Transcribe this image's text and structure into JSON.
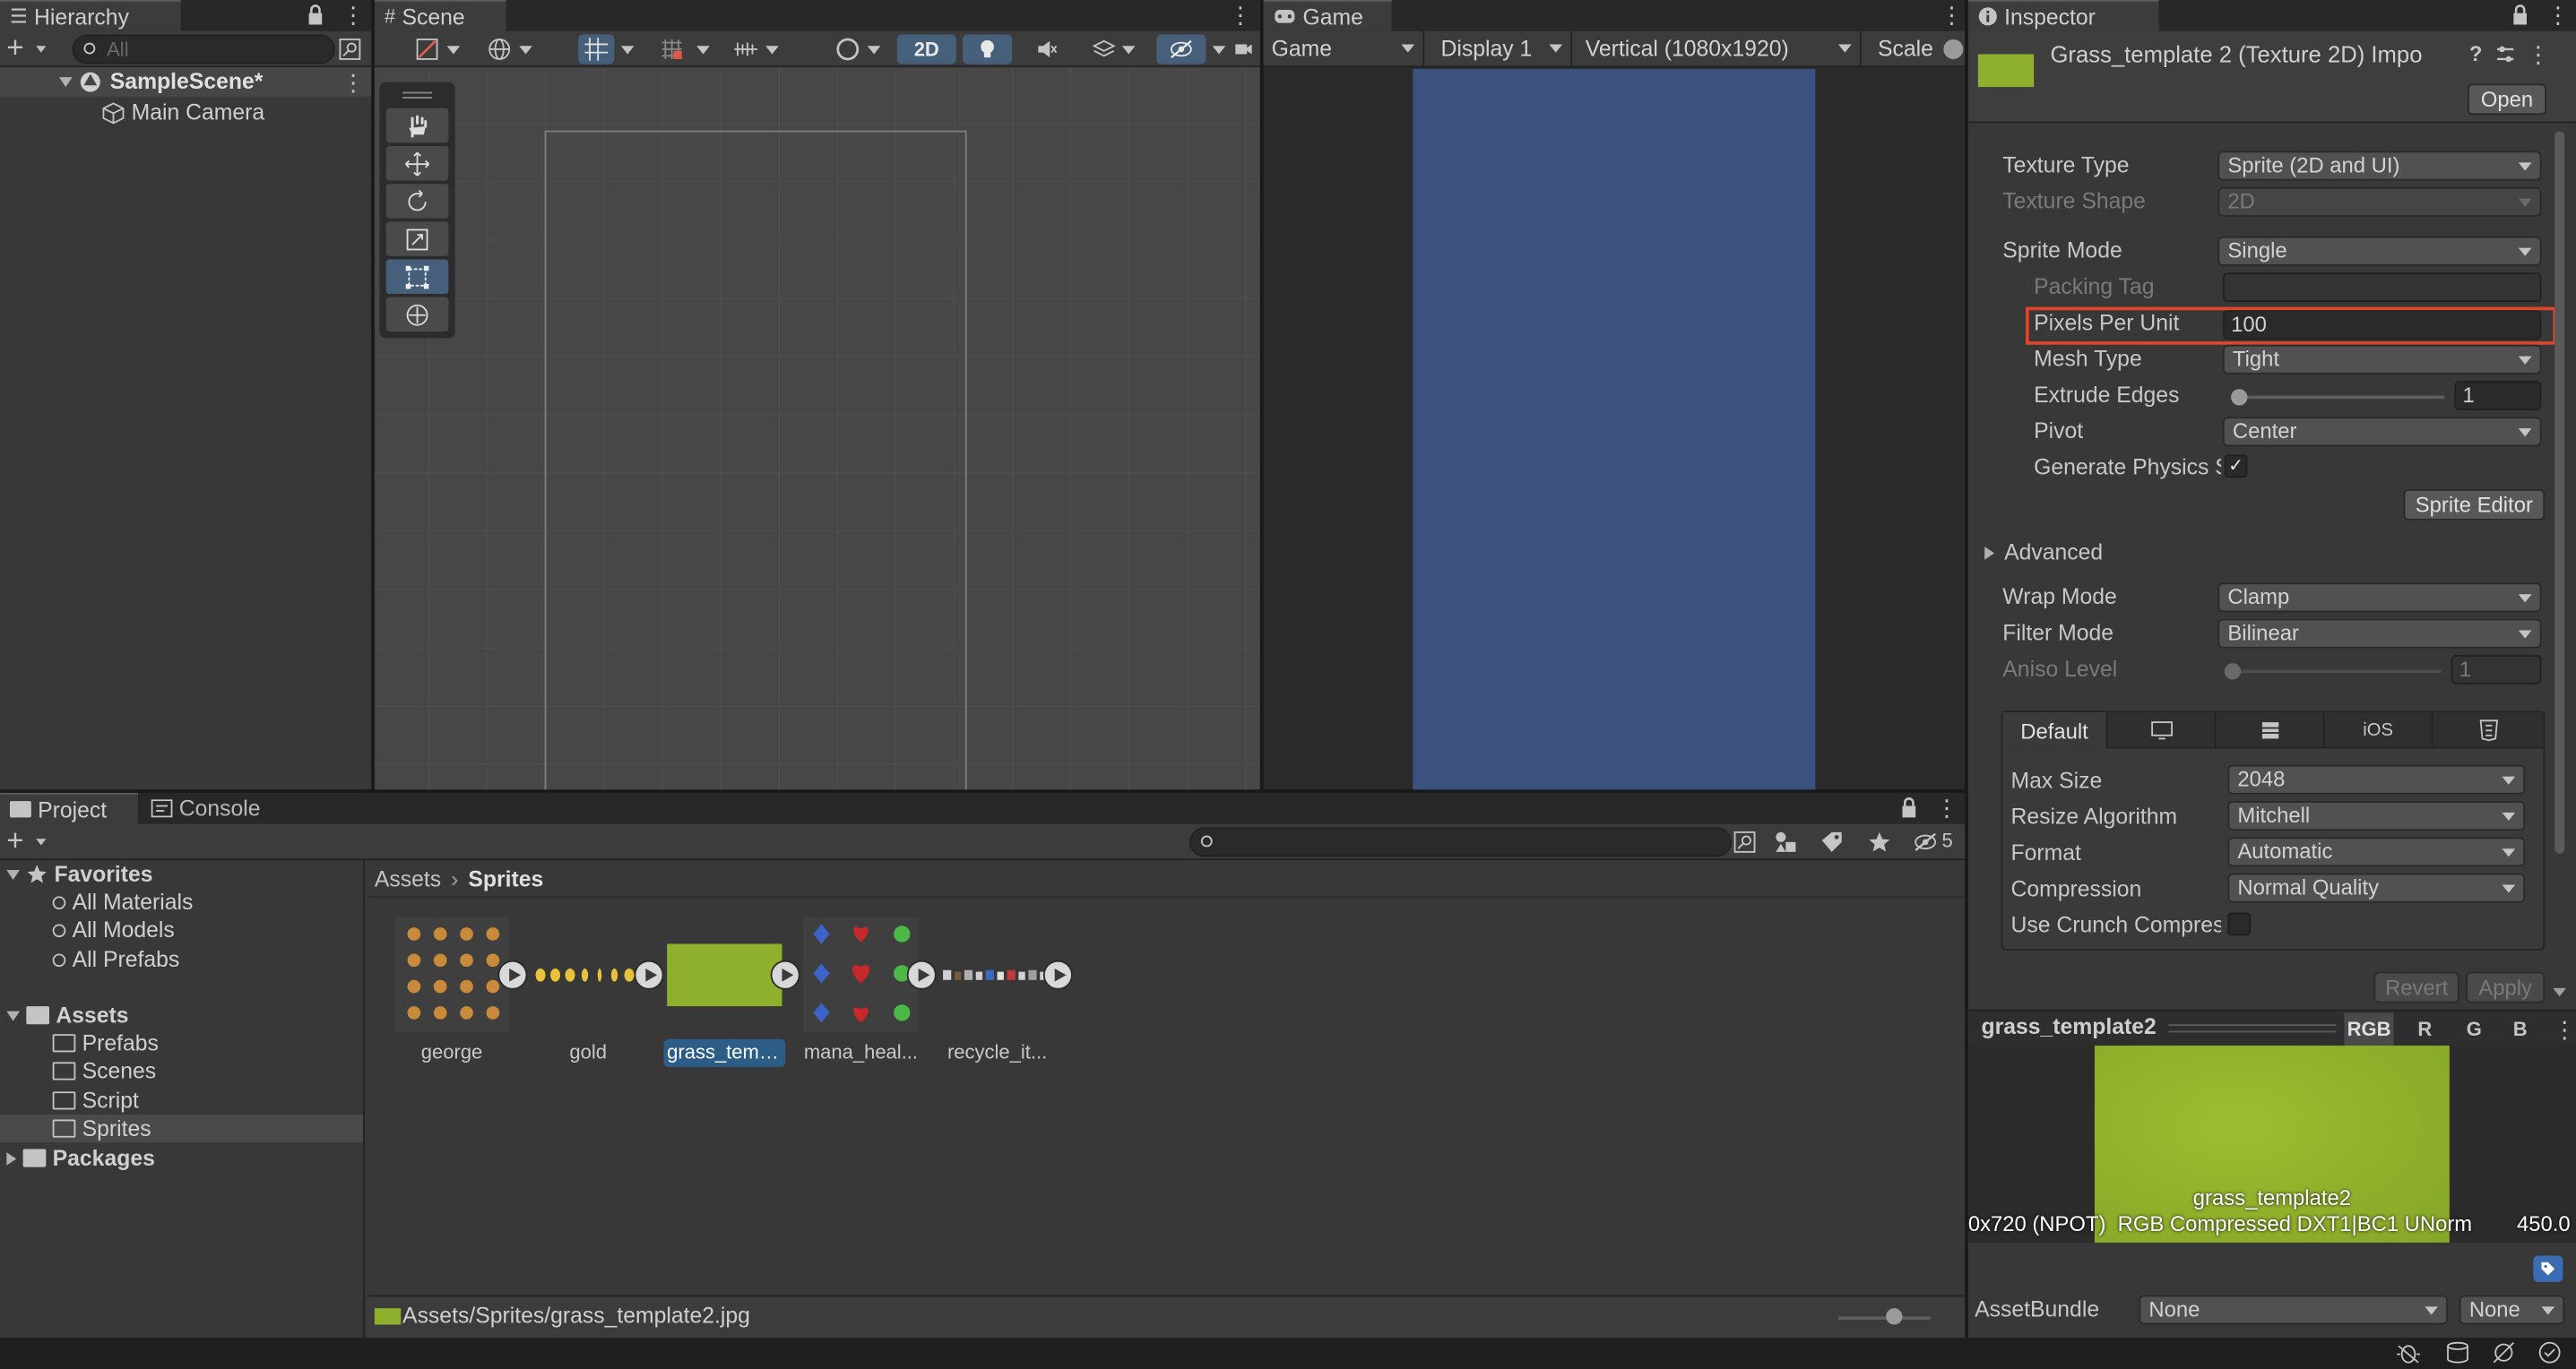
{
  "hierarchy": {
    "tab_label": "Hierarchy",
    "search_placeholder": "All",
    "scene_name": "SampleScene*",
    "items": [
      "Main Camera"
    ]
  },
  "scene": {
    "tab_label": "Scene",
    "mode_2d_label": "2D"
  },
  "game": {
    "tab_label": "Game",
    "view_dropdown": "Game",
    "display_dropdown": "Display 1",
    "resolution_dropdown": "Vertical (1080x1920)",
    "scale_label": "Scale",
    "colors": {
      "viewport": "#3b5281",
      "letterbox": "#2a2a2a"
    }
  },
  "inspector": {
    "tab_label": "Inspector",
    "title": "Grass_template 2 (Texture 2D) Impo",
    "open_button": "Open",
    "rows": {
      "texture_type": {
        "label": "Texture Type",
        "value": "Sprite (2D and UI)"
      },
      "texture_shape": {
        "label": "Texture Shape",
        "value": "2D"
      },
      "sprite_mode": {
        "label": "Sprite Mode",
        "value": "Single"
      },
      "packing_tag": {
        "label": "Packing Tag",
        "value": ""
      },
      "pixels_per_unit": {
        "label": "Pixels Per Unit",
        "value": "100"
      },
      "mesh_type": {
        "label": "Mesh Type",
        "value": "Tight"
      },
      "extrude_edges": {
        "label": "Extrude Edges",
        "value": "1",
        "fraction": 0.0
      },
      "pivot": {
        "label": "Pivot",
        "value": "Center"
      },
      "generate_physics": {
        "label": "Generate Physics S",
        "checked": "✓"
      },
      "wrap_mode": {
        "label": "Wrap Mode",
        "value": "Clamp"
      },
      "filter_mode": {
        "label": "Filter Mode",
        "value": "Bilinear"
      },
      "aniso_level": {
        "label": "Aniso Level",
        "value": "1",
        "fraction": 0.0
      }
    },
    "sprite_editor_button": "Sprite Editor",
    "advanced_label": "Advanced",
    "platform_tabs": {
      "default": "Default",
      "ios": "iOS"
    },
    "platform_rows": {
      "max_size": {
        "label": "Max Size",
        "value": "2048"
      },
      "resize_algorithm": {
        "label": "Resize Algorithm",
        "value": "Mitchell"
      },
      "format": {
        "label": "Format",
        "value": "Automatic"
      },
      "compression": {
        "label": "Compression",
        "value": "Normal Quality"
      },
      "use_crunch": {
        "label": "Use Crunch Compres"
      }
    },
    "revert_button": "Revert",
    "apply_button": "Apply",
    "preview": {
      "name": "grass_template2",
      "channels": [
        "RGB",
        "R",
        "G",
        "B"
      ],
      "caption": "grass_template2",
      "info_left": "0x720 (NPOT)  RGB Compressed DXT1|BC1 UNorm",
      "info_right": "450.0"
    },
    "assetbundle": {
      "label": "AssetBundle",
      "value1": "None",
      "value2": "None"
    },
    "highlight_color": "#e0452a",
    "grass_color": "#8fb02c"
  },
  "project": {
    "tabs": {
      "project": "Project",
      "console": "Console"
    },
    "hidden_count": "5",
    "favorites": {
      "label": "Favorites",
      "items": [
        "All Materials",
        "All Models",
        "All Prefabs"
      ]
    },
    "assets": {
      "label": "Assets",
      "folders": [
        "Prefabs",
        "Scenes",
        "Script",
        "Sprites"
      ]
    },
    "packages_label": "Packages",
    "breadcrumb": {
      "root": "Assets",
      "current": "Sprites"
    },
    "files": [
      "george",
      "gold",
      "grass_temp...",
      "mana_heal...",
      "recycle_it..."
    ],
    "footer_path": "Assets/Sprites/grass_template2.jpg"
  }
}
